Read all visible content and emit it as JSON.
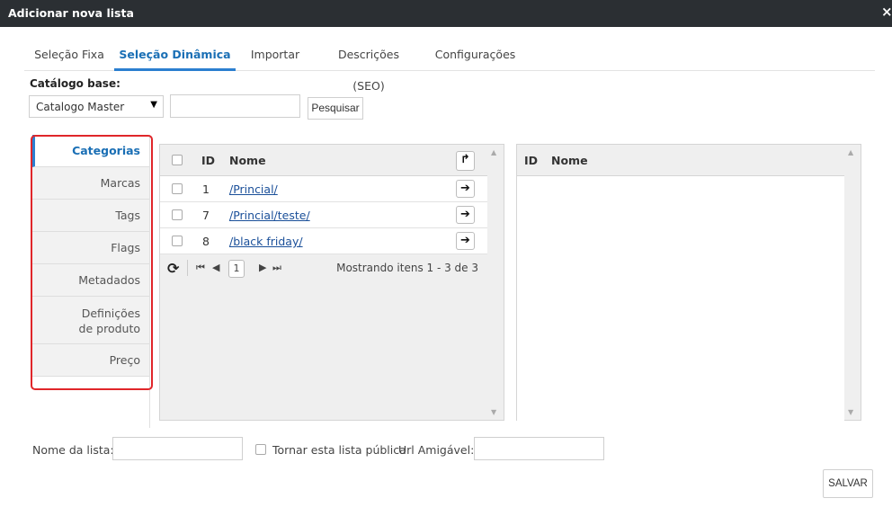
{
  "window": {
    "title": "Adicionar nova lista",
    "close": "×"
  },
  "tabs": [
    {
      "label": "Seleção Fixa"
    },
    {
      "label": "Seleção Dinâmica"
    },
    {
      "label": "Importar"
    },
    {
      "label": "Descrições (SEO)"
    },
    {
      "label": "Configurações"
    }
  ],
  "catalog": {
    "label": "Catálogo base:",
    "selected": "Catalogo Master",
    "search_placeholder": "",
    "search_button": "Pesquisar"
  },
  "leftnav": {
    "items": [
      {
        "label": "Categorias"
      },
      {
        "label": "Marcas"
      },
      {
        "label": "Tags"
      },
      {
        "label": "Flags"
      },
      {
        "label": "Metadados"
      },
      {
        "label": "Definições de produto"
      },
      {
        "label": "Preço"
      }
    ]
  },
  "left_grid": {
    "columns": {
      "id": "ID",
      "name": "Nome"
    },
    "rows": [
      {
        "id": "1",
        "name": "/Princial/"
      },
      {
        "id": "7",
        "name": "/Princial/teste/"
      },
      {
        "id": "8",
        "name": "/black friday/"
      }
    ],
    "pager": {
      "page": "1",
      "status": "Mostrando itens 1 - 3 de 3"
    }
  },
  "right_grid": {
    "columns": {
      "id": "ID",
      "name": "Nome"
    }
  },
  "bottom": {
    "list_name_label": "Nome da lista:",
    "public_label": "Tornar esta lista pública",
    "friendly_url_label": "Url Amigável:",
    "save_button": "SALVAR"
  },
  "colors": {
    "accent": "#2b7fd0",
    "highlight": "#e0262a",
    "titlebar": "#2b2f33"
  }
}
